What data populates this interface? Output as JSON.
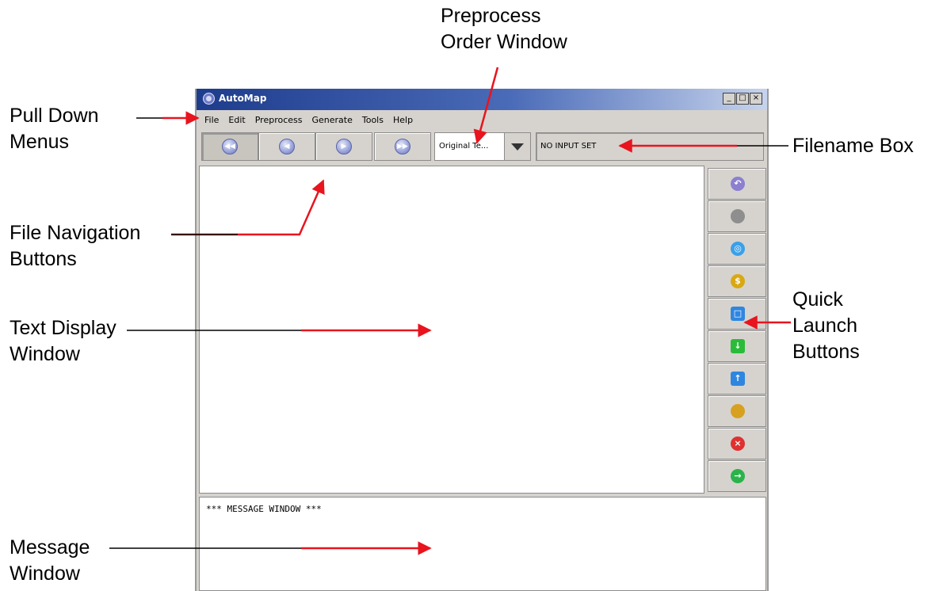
{
  "window": {
    "title": "AutoMap",
    "controls": [
      "_",
      "□",
      "×"
    ],
    "menus": [
      "File",
      "Edit",
      "Preprocess",
      "Generate",
      "Tools",
      "Help"
    ],
    "nav_buttons": [
      {
        "name": "first",
        "glyph": "◀◀"
      },
      {
        "name": "previous",
        "glyph": "◀"
      },
      {
        "name": "next",
        "glyph": "▶"
      },
      {
        "name": "last",
        "glyph": "▶▶"
      }
    ],
    "preprocess_order_value": "Original Te...",
    "filename_value": "NO INPUT SET",
    "quick_launch": [
      {
        "icon": "undo-icon",
        "color": "#8c7fd0",
        "glyph": "↶"
      },
      {
        "icon": "trash-icon",
        "color": "#8e8e8e",
        "glyph": ""
      },
      {
        "icon": "target-icon",
        "color": "#3ba0e8",
        "glyph": "◎"
      },
      {
        "icon": "coin-icon",
        "color": "#d9a812",
        "glyph": "$"
      },
      {
        "icon": "square-icon",
        "color": "#2f86e0",
        "glyph": "□"
      },
      {
        "icon": "download-icon",
        "color": "#2bbb3a",
        "glyph": "↓"
      },
      {
        "icon": "upload-icon",
        "color": "#2f86e0",
        "glyph": "↑"
      },
      {
        "icon": "database-icon",
        "color": "#d8a020",
        "glyph": ""
      },
      {
        "icon": "stop-icon",
        "color": "#e03030",
        "glyph": "×"
      },
      {
        "icon": "go-icon",
        "color": "#2bb34a",
        "glyph": "→"
      }
    ],
    "message_text": "*** MESSAGE WINDOW ***"
  },
  "callouts": {
    "pull_down_menus": [
      "Pull Down",
      "Menus"
    ],
    "preprocess_order_window": [
      "Preprocess",
      "Order Window"
    ],
    "filename_box": [
      "Filename Box"
    ],
    "file_navigation_buttons": [
      "File Navigation",
      "Buttons"
    ],
    "text_display_window": [
      "Text Display",
      "Window"
    ],
    "quick_launch_buttons": [
      "Quick",
      "Launch",
      "Buttons"
    ],
    "message_window": [
      "Message",
      "Window"
    ]
  },
  "arrow_color": "#e8141e"
}
